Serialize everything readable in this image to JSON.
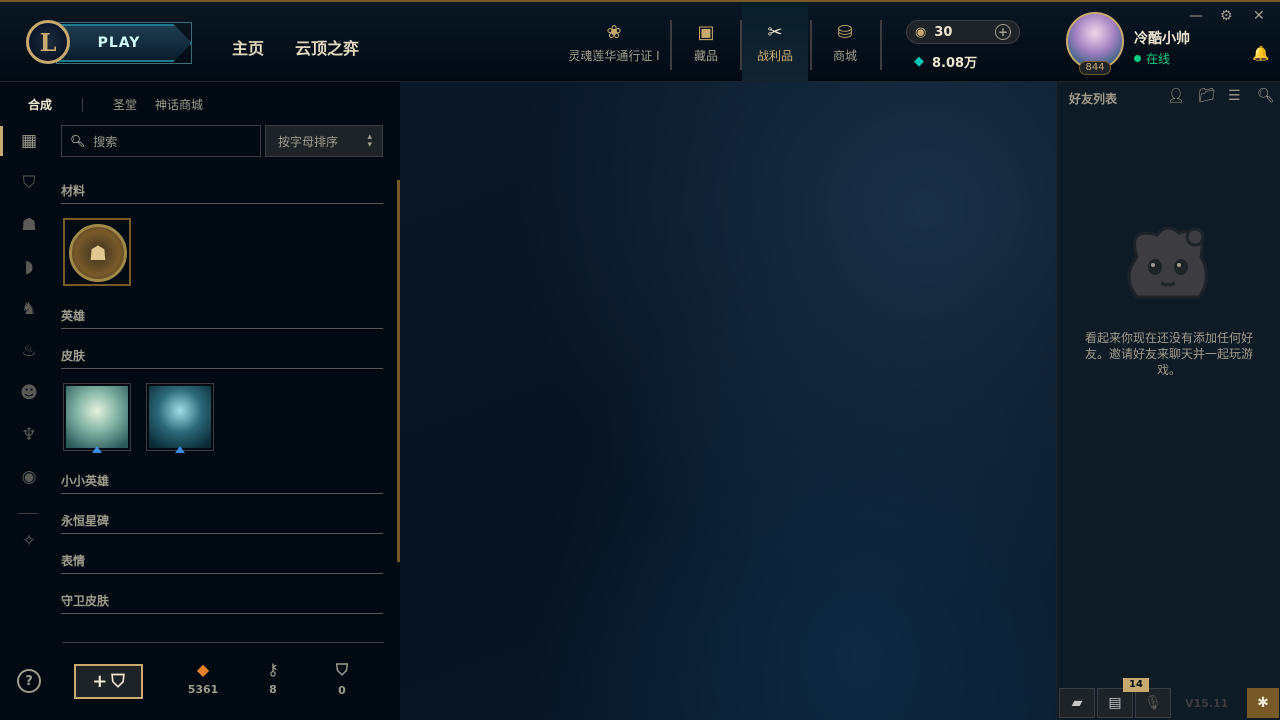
{
  "topbar": {
    "play_label": "PLAY",
    "home_label": "主页",
    "tft_label": "云顶之弈",
    "icon_nav": [
      {
        "label": "灵魂莲华通行证 I",
        "icon": "lotus-icon"
      },
      {
        "label": "藏品",
        "icon": "collection-icon"
      },
      {
        "label": "战利品",
        "icon": "loot-icon",
        "active": true
      },
      {
        "label": "商城",
        "icon": "store-icon"
      }
    ],
    "rp_amount": "30",
    "be_amount": "8.08万",
    "username": "冷酷小帅",
    "status": "在线",
    "level": "844"
  },
  "loot": {
    "subtabs": [
      "合成",
      "圣堂",
      "神话商城"
    ],
    "search_placeholder": "搜索",
    "sort_label": "按字母排序",
    "sections": {
      "materials": "材料",
      "champions": "英雄",
      "skins": "皮肤",
      "tft": "小小英雄",
      "eternals": "永恒星碑",
      "emotes": "表情",
      "ward_skins": "守卫皮肤"
    },
    "resources": [
      {
        "icon": "orange-essence-icon",
        "value": "5361"
      },
      {
        "icon": "key-icon",
        "value": "8"
      },
      {
        "icon": "chest-icon",
        "value": "0"
      }
    ],
    "craft_icon": "chest-icon"
  },
  "friends": {
    "title": "好友列表",
    "empty_text": "看起来你现在还没有添加任何好友。邀请好友来聊天并一起玩游戏。",
    "unread_count": "14",
    "version": "V15.11"
  },
  "colors": {
    "gold": "#c8aa6e",
    "dark_bg": "#010a13",
    "teal": "#1e7a8c",
    "online_green": "#0acf83"
  }
}
